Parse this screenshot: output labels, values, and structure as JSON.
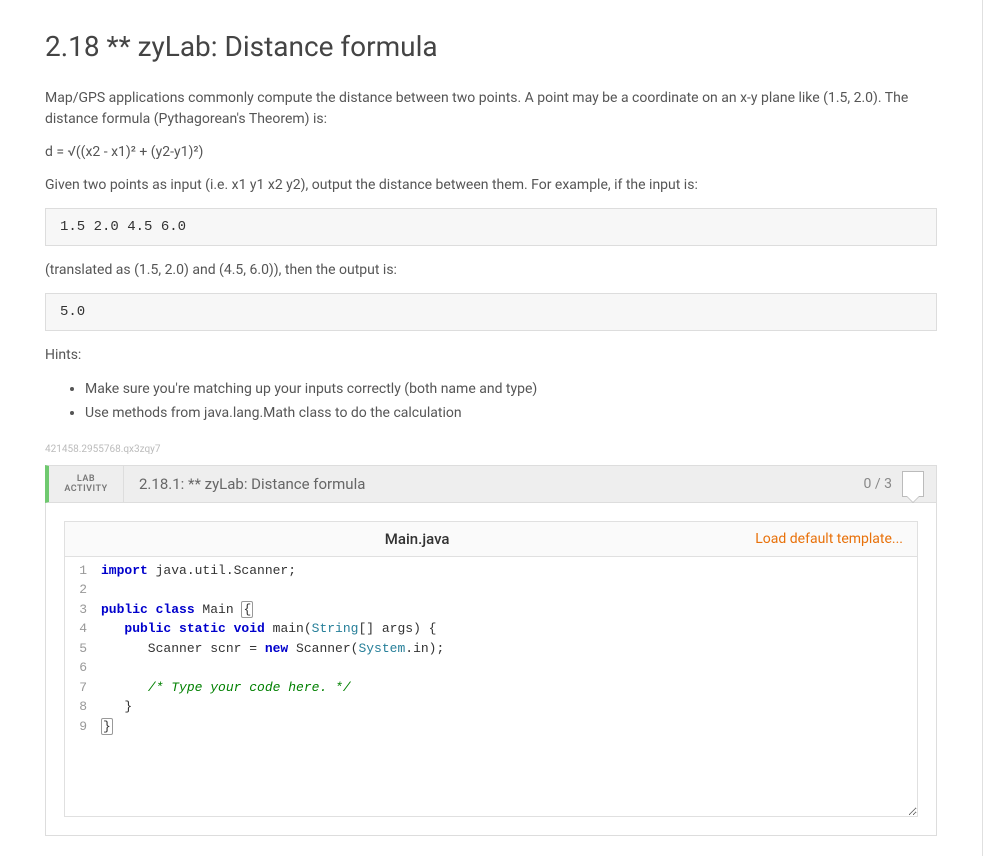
{
  "title": "2.18 ** zyLab: Distance formula",
  "description": {
    "intro": "Map/GPS applications commonly compute the distance between two points. A point may be a coordinate on an x-y plane like (1.5, 2.0). The distance formula (Pythagorean's Theorem) is:",
    "formula": "d = √((x2 - x1)² + (y2-y1)²)",
    "given": "Given two points as input (i.e. x1 y1 x2 y2), output the distance between them. For example, if the input is:",
    "exampleInput": "1.5 2.0 4.5 6.0",
    "translated": "(translated as (1.5, 2.0) and (4.5, 6.0)), then the output is:",
    "exampleOutput": "5.0",
    "hintsLabel": "Hints:"
  },
  "hints": [
    "Make sure you're matching up your inputs correctly (both name and type)",
    "Use methods from java.lang.Math class to do the calculation"
  ],
  "seed": "421458.2955768.qx3zqy7",
  "activity": {
    "labelTop": "LAB",
    "labelBottom": "ACTIVITY",
    "title": "2.18.1: ** zyLab: Distance formula",
    "score": "0 / 3"
  },
  "editor": {
    "filename": "Main.java",
    "loadDefault": "Load default template...",
    "lines": [
      1,
      2,
      3,
      4,
      5,
      6,
      7,
      8,
      9
    ],
    "code": {
      "l1_import": "import",
      "l1_pkg": " java.util.Scanner;",
      "l3_public": "public",
      "l3_class": " class",
      "l3_name": " Main ",
      "l3_brace": "{",
      "l4_public": "public",
      "l4_static": " static",
      "l4_void": " void",
      "l4_main": " main(",
      "l4_string": "String",
      "l4_args": "[] args) {",
      "l5_pre": "      Scanner scnr = ",
      "l5_new": "new",
      "l5_mid": " Scanner(",
      "l5_system": "System",
      "l5_end": ".in);",
      "l7_cmt": "/* Type your code here. */",
      "l8_close": "   }",
      "l9_close": "}"
    }
  }
}
